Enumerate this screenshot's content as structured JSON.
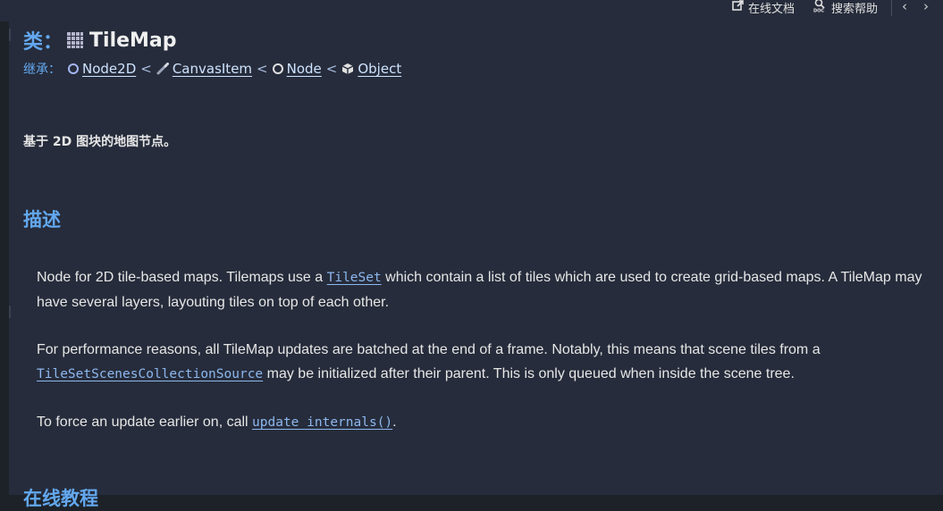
{
  "toolbar": {
    "online_docs_label": "在线文档",
    "search_help_label": "搜索帮助",
    "back_icon": "chevron-left-icon",
    "forward_icon": "chevron-right-icon"
  },
  "header": {
    "class_prefix": "类：",
    "class_name": "TileMap",
    "inherits_label": "继承：",
    "inherits_chain": [
      "Node2D",
      "CanvasItem",
      "Node",
      "Object"
    ],
    "separator": "<"
  },
  "brief_description": "基于 2D 图块的地图节点。",
  "description": {
    "title": "描述",
    "p1_before": "Node for 2D tile-based maps. Tilemaps use a ",
    "p1_link": "TileSet",
    "p1_after": " which contain a list of tiles which are used to create grid-based maps. A TileMap may have several layers, layouting tiles on top of each other.",
    "p2_before": "For performance reasons, all TileMap updates are batched at the end of a frame. Notably, this means that scene tiles from a ",
    "p2_link": "TileSetScenesCollectionSource",
    "p2_after": " may be initialized after their parent. This is only queued when inside the scene tree.",
    "p3_before": "To force an update earlier on, call ",
    "p3_link": "update_internals()",
    "p3_after": "."
  },
  "tutorials": {
    "title": "在线教程"
  },
  "colors": {
    "accent": "#63a8ef",
    "background": "#262c3b",
    "link": "#8db7ee"
  }
}
